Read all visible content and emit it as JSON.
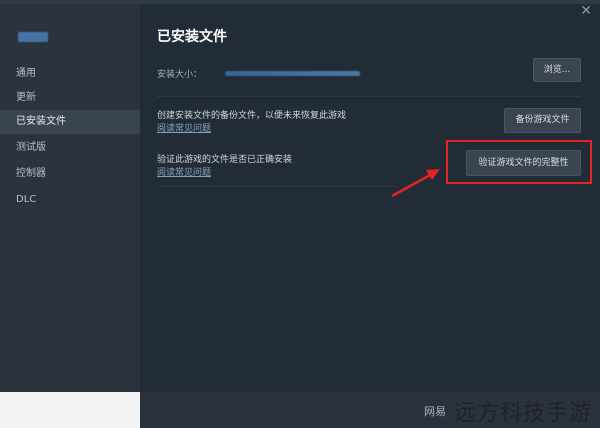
{
  "sidebar": {
    "items": [
      {
        "label": "通用"
      },
      {
        "label": "更新"
      },
      {
        "label": "已安装文件",
        "active": true
      },
      {
        "label": "测试版"
      },
      {
        "label": "控制器"
      },
      {
        "label": "DLC"
      }
    ]
  },
  "main": {
    "title": "已安装文件",
    "install_size_label": "安装大小：",
    "browse_button": "浏览...",
    "backup": {
      "text": "创建安装文件的备份文件，以便未来恢复此游戏",
      "link": "阅读常见问题",
      "button": "备份游戏文件"
    },
    "verify": {
      "text": "验证此游戏的文件是否已正确安装",
      "link": "阅读常见问题",
      "button": "验证游戏文件的完整性"
    }
  },
  "icons": {
    "close": "close-icon"
  },
  "annotation": {
    "highlight_color": "#e62222"
  },
  "footer": {
    "small_text": "网易",
    "watermark": "远方科技手游"
  }
}
